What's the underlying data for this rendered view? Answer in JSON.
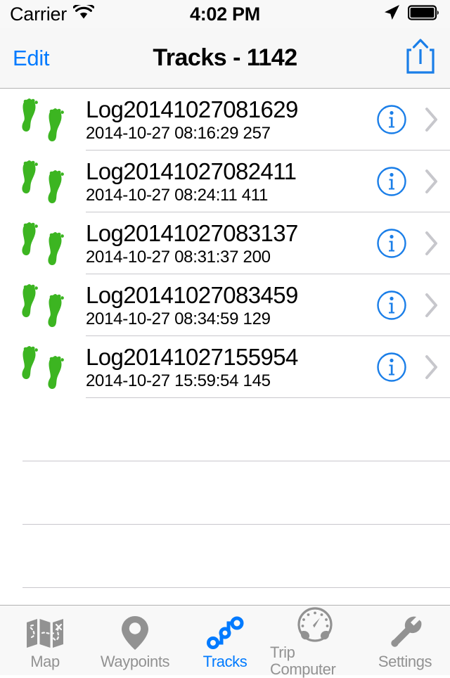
{
  "status_bar": {
    "carrier": "Carrier",
    "wifi_icon": "wifi-icon",
    "time": "4:02 PM",
    "location_icon": "location-arrow-icon",
    "battery_icon": "battery-full-icon"
  },
  "nav_bar": {
    "edit_label": "Edit",
    "title": "Tracks - 1142",
    "share_icon": "share-icon",
    "accent_color": "#007aff"
  },
  "list": {
    "row_icon": "footprints-icon",
    "info_icon": "info-circle-icon",
    "chevron_icon": "chevron-right-icon",
    "rows": [
      {
        "title": "Log20141027081629",
        "subtitle": "2014-10-27 08:16:29 257"
      },
      {
        "title": "Log20141027082411",
        "subtitle": "2014-10-27 08:24:11 411"
      },
      {
        "title": "Log20141027083137",
        "subtitle": "2014-10-27 08:31:37 200"
      },
      {
        "title": "Log20141027083459",
        "subtitle": "2014-10-27 08:34:59 129"
      },
      {
        "title": "Log20141027155954",
        "subtitle": "2014-10-27 15:59:54 145"
      }
    ],
    "empty_row_count": 3,
    "footprint_color": "#3cb521",
    "separator_color": "#c8c7cc"
  },
  "tab_bar": {
    "active_color": "#007aff",
    "inactive_color": "#929292",
    "tabs": [
      {
        "label": "Map",
        "icon": "map-icon",
        "active": false
      },
      {
        "label": "Waypoints",
        "icon": "map-pin-icon",
        "active": false
      },
      {
        "label": "Tracks",
        "icon": "track-nodes-icon",
        "active": true
      },
      {
        "label": "Trip Computer",
        "icon": "gauge-icon",
        "active": false
      },
      {
        "label": "Settings",
        "icon": "wrench-icon",
        "active": false
      }
    ]
  }
}
